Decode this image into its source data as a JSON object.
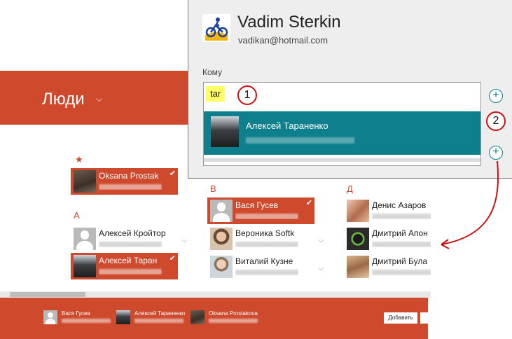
{
  "app": {
    "title": "Люди"
  },
  "groups": {
    "favorites": {
      "header": "★",
      "tiles": [
        {
          "name": "Oksana Prostak",
          "selected": true
        }
      ]
    },
    "a": {
      "header": "А",
      "tiles": [
        {
          "name": "Алексей Кройтор",
          "selected": false
        },
        {
          "name": "Алексей Таран",
          "selected": true
        }
      ]
    },
    "v": {
      "header": "В",
      "tiles": [
        {
          "name": "Вася Гусев",
          "selected": true
        },
        {
          "name": "Вероника Softk",
          "selected": false
        },
        {
          "name": "Виталий Кузне",
          "selected": false
        }
      ]
    },
    "d": {
      "header": "Д",
      "tiles": [
        {
          "name": "Денис Азаров",
          "selected": false
        },
        {
          "name": "Дмитрий Апон",
          "selected": false
        },
        {
          "name": "Дмитрий Була",
          "selected": false
        }
      ]
    }
  },
  "app_bar": {
    "selected": [
      {
        "name": "Вася Гусев"
      },
      {
        "name": "Алексей Тараненко"
      },
      {
        "name": "Oksana Prostakova"
      }
    ],
    "add_label": "Добавить"
  },
  "share": {
    "user_name": "Vadim Sterkin",
    "user_email": "vadikan@hotmail.com",
    "to_label": "Кому",
    "typed_text": "tar",
    "suggestion_name": "Алексей Тараненко"
  },
  "annotations": {
    "badge_1": "1",
    "badge_2": "2"
  },
  "icons": {
    "check": "checkmark-icon",
    "expand": "chevron-down-icon",
    "plus": "plus-circle-icon"
  },
  "colors": {
    "accent": "#cf4a2d",
    "teal": "#0e7f8c",
    "highlight": "#ffff66",
    "annotation_red": "#cc1111"
  }
}
